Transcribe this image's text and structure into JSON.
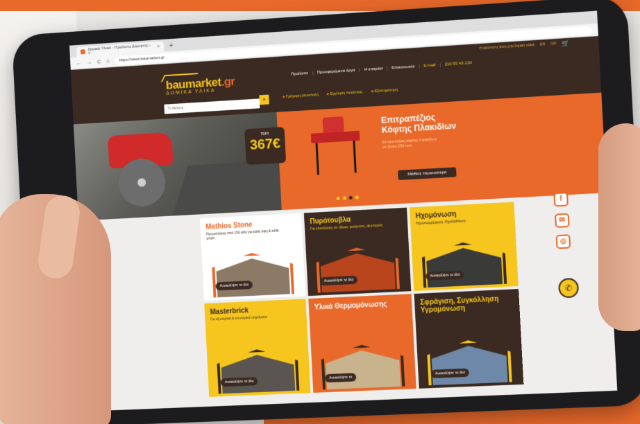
{
  "browser": {
    "tab_title": "Δομικά Υλικά - Προϊόντα Δόμησης - Υ",
    "tab_close": "×",
    "new_tab": "+",
    "url": "https://www.baumarket.gr",
    "back": "←",
    "forward": "→",
    "reload": "C",
    "home": "⌂"
  },
  "site": {
    "topbar_text": "Η αξιόπιστη λύση στα δομικά υλικά",
    "lang": "EN",
    "lang_alt": "GR",
    "cart_icon": "cart-icon",
    "logo": {
      "main": "baumarket",
      "tld": ".gr",
      "sub": "ΔΟΜΙΚΑ ΥΛΙΚΑ"
    },
    "nav": [
      "Προϊόντα",
      "Προσφερόμενα έργα",
      "Η εταιρεία",
      "Επικοινωνία"
    ],
    "email": "E-mail",
    "phone": "210 55 43 220",
    "search_placeholder": "Τι θέλετε;",
    "search_icon": "search-icon",
    "features": [
      "Γρήγορη αποστολή",
      "Εγγύηση ποιότητας",
      "Εξυπηρέτηση"
    ]
  },
  "hero": {
    "price_label": "ΤΙΜΗ",
    "price": "367€",
    "promo_title_1": "Επιτραπέζιος",
    "promo_title_2": "Κόφτης Πλακιδίων",
    "promo_desc": "Επιτραπέζιος κόφτης πλακιδίων με δίσκο 250 mm",
    "promo_button": "Μάθετε περισσότερα",
    "slides": 4,
    "active_slide": 3
  },
  "categories": [
    {
      "title": "Mathios Stone",
      "desc": "Πετροπλάκες από 150 είδη για κάθε όψη & κάθε χώρο",
      "cta": "Ανακαλύψτε τα όλα",
      "style": "c-white"
    },
    {
      "title": "Πυρότουβλα",
      "desc": "Για επενδύσεις σε τζάκια, φούρνους, ψησταριές",
      "cta": "Ανακαλύψτε τα όλα",
      "style": "c-brown"
    },
    {
      "title": "Ηχομόνωση",
      "desc": "Ηχοαπορρόφηση, Ηχοδιάθλαση",
      "cta": "Ανακαλύψτε τα όλα",
      "style": "c-yellow"
    },
    {
      "title": "Masterbrick",
      "desc": "Για εξωτερικά & εσωτερικά τοιχώματα",
      "cta": "Ανακαλύψτε τα όλα",
      "style": "c-yellow"
    },
    {
      "title": "Υλικά Θερμομόνωσης",
      "desc": "",
      "cta": "Ανακαλύψτε τα",
      "style": "c-orange"
    },
    {
      "title": "Σφράγιση, Συγκόλληση Υγρομόνωση",
      "desc": "",
      "cta": "Ανακαλύψτε τα όλα",
      "style": "c-brown"
    }
  ],
  "social": {
    "facebook": "f",
    "email": "✉",
    "instagram": "◎",
    "whatsapp": "✆"
  },
  "colors": {
    "brand_brown": "#3b2a21",
    "brand_orange": "#e8692a",
    "brand_yellow": "#f6c61e"
  }
}
